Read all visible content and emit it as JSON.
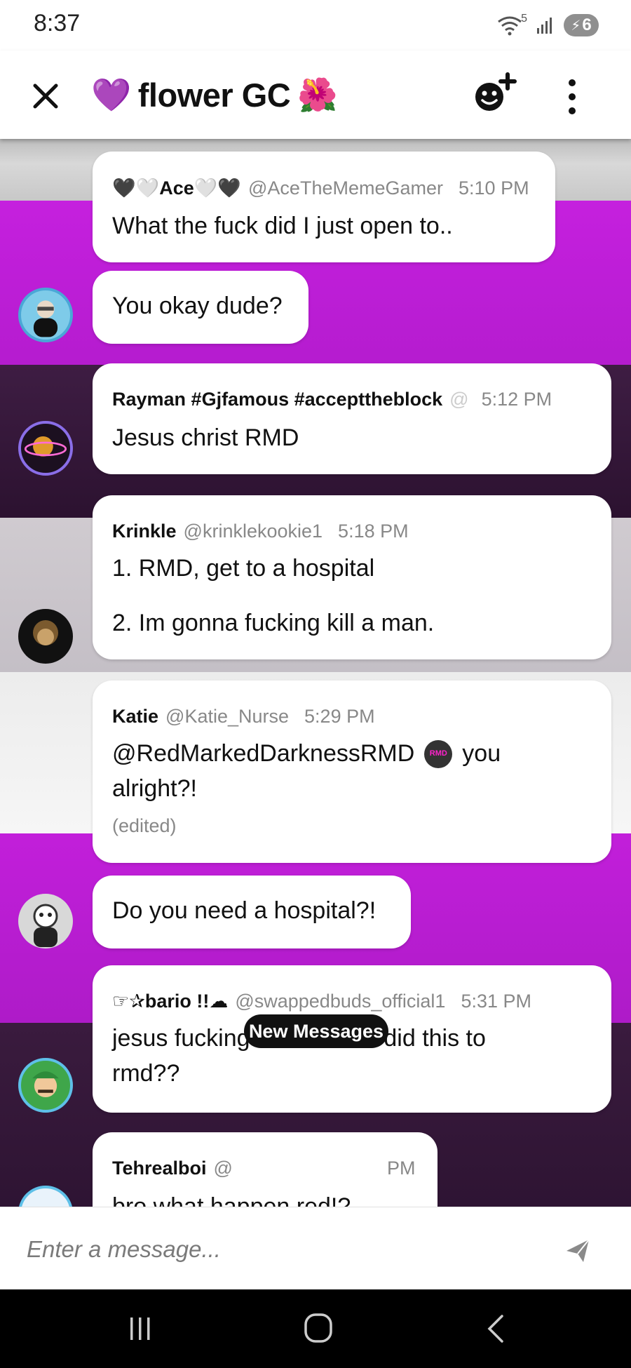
{
  "status_bar": {
    "time": "8:37",
    "network_badge": "5",
    "battery": "6"
  },
  "header": {
    "close_icon": "close-icon",
    "title": "flower GC",
    "title_left_emoji": "💜",
    "title_right_emoji": "🌺"
  },
  "messages": [
    {
      "name": "🖤🤍Ace🤍🖤",
      "handle": "@AceTheMemeGamer",
      "time": "5:10 PM",
      "text": "What the fuck did I just open to.."
    },
    {
      "text": "You okay dude?"
    },
    {
      "name": "Rayman #Gjfamous #accepttheblock",
      "handle": "@",
      "time": "5:12 PM",
      "text": "Jesus christ RMD"
    },
    {
      "name": "Krinkle",
      "handle": "@krinklekookie1",
      "time": "5:18 PM",
      "lines": [
        "1.  RMD, get to a hospital",
        "2.  Im gonna fucking kill a man."
      ]
    },
    {
      "name": "Katie",
      "handle": "@Katie_Nurse",
      "time": "5:29 PM",
      "mention": "@RedMarkedDarknessRMD",
      "mention_badge": "RMD",
      "text_after": "you",
      "line2": "alright?!",
      "edited": "(edited)"
    },
    {
      "text": "Do you need a hospital?!"
    },
    {
      "name": "☞✰bario !!☁",
      "handle": "@swappedbuds_official1",
      "time": "5:31 PM",
      "lines": [
        "jesus fucking christ.. who did this to",
        "rmd??"
      ]
    },
    {
      "name": "Tehrealboi",
      "handle": "@",
      "time_suffix": "PM",
      "text": "bro what happen red!?"
    }
  ],
  "new_messages_pill": "New Messages",
  "composer": {
    "placeholder": "Enter a message..."
  },
  "colors": {
    "purple": "#b61fd0",
    "dark_purple": "#3a1b3e",
    "light_gray": "#cfcfcf",
    "white_stripe": "#eeeeee"
  },
  "icons": [
    "close-icon",
    "add-member-icon",
    "more-vertical-icon",
    "send-icon",
    "wifi-icon",
    "signal-icon",
    "battery-icon",
    "recents-icon",
    "home-icon",
    "back-icon"
  ]
}
